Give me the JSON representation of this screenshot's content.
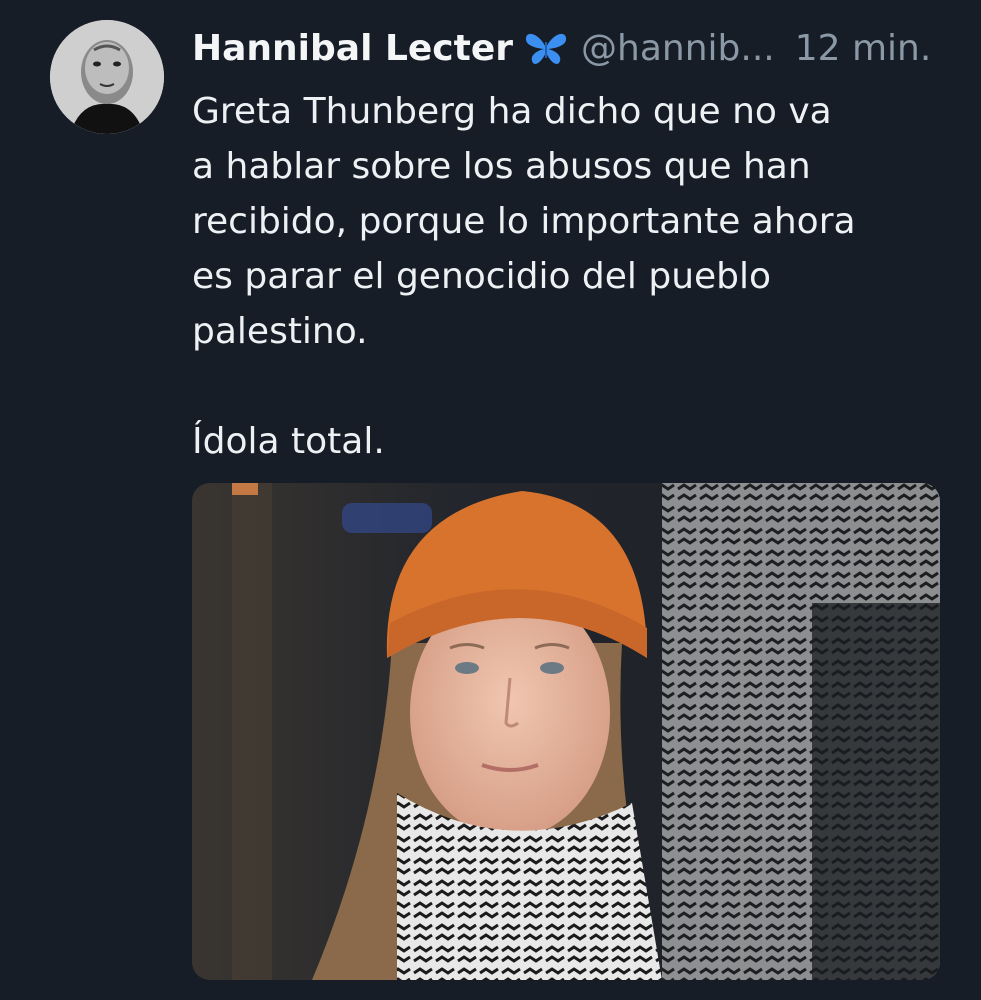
{
  "tweet": {
    "author_name": "Hannibal Lecter",
    "verified_icon": "butterfly-icon",
    "handle": "@hannib...",
    "time": "12 min.",
    "text_lines": [
      "Greta Thunberg ha dicho que no va",
      "a hablar sobre los abusos que han",
      "recibido, porque lo importante ahora",
      "es parar el genocidio del pueblo",
      "palestino."
    ],
    "text_last": "Ídola total.",
    "media": {
      "kind": "photo",
      "description": "young woman with orange beanie and keffiyeh scarf"
    }
  },
  "colors": {
    "background": "#161d27",
    "text": "#eef1f4",
    "muted": "#8b98a5",
    "badge": "#3b8ff0",
    "beanie": "#d8732d"
  }
}
